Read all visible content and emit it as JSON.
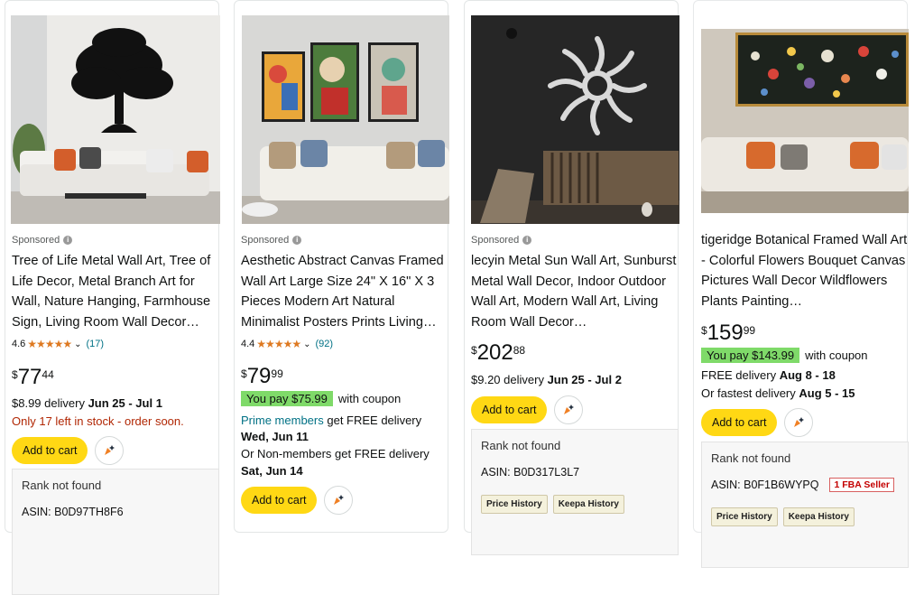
{
  "cards": [
    {
      "sponsored": "Sponsored",
      "title": "Tree of Life Metal Wall Art, Tree of Life Decor, Metal Branch Art for Wall, Nature Hanging, Farmhouse Sign, Living Room Wall Decor…",
      "rating": "4.6",
      "rating_fraction": 0.92,
      "review_count": "(17)",
      "price_symbol": "$",
      "price_whole": "77",
      "price_fraction": "44",
      "delivery_prefix": "$8.99 delivery ",
      "delivery_dates": "Jun 25 - Jul 1",
      "stock": "Only 17 left in stock - order soon.",
      "add_to_cart": "Add to cart",
      "rank": "Rank not found",
      "asin": "ASIN: B0D97TH8F6"
    },
    {
      "sponsored": "Sponsored",
      "title": "Aesthetic Abstract Canvas Framed Wall Art Large Size 24\" X 16\" X 3 Pieces Modern Art Natural Minimalist Posters Prints Living…",
      "rating": "4.4",
      "rating_fraction": 0.88,
      "review_count": "(92)",
      "price_symbol": "$",
      "price_whole": "79",
      "price_fraction": "99",
      "you_pay": "You pay $75.99",
      "with_coupon": "with coupon",
      "prime_link": "Prime members",
      "prime_rest": " get FREE delivery",
      "prime_date": "Wed, Jun 11",
      "nonmember": "Or Non-members get FREE delivery",
      "nonmember_date": "Sat, Jun 14",
      "add_to_cart": "Add to cart"
    },
    {
      "sponsored": "Sponsored",
      "title": "lecyin Metal Sun Wall Art, Sunburst Metal Wall Decor, Indoor Outdoor Wall Art, Modern Wall Art, Living Room Wall Decor…",
      "price_symbol": "$",
      "price_whole": "202",
      "price_fraction": "88",
      "delivery_prefix": "$9.20 delivery ",
      "delivery_dates": "Jun 25 - Jul 2",
      "add_to_cart": "Add to cart",
      "rank": "Rank not found",
      "asin": "ASIN: B0D317L3L7",
      "price_history": "Price History",
      "keepa_history": "Keepa History"
    },
    {
      "title": "tigeridge Botanical Framed Wall Art - Colorful Flowers Bouquet Canvas Pictures Wall Decor Wildflowers Plants Painting…",
      "price_symbol": "$",
      "price_whole": "159",
      "price_fraction": "99",
      "you_pay": "You pay $143.99",
      "with_coupon": "with coupon",
      "free_delivery": "FREE delivery ",
      "free_dates": "Aug 8 - 18",
      "fastest": "Or fastest delivery ",
      "fastest_dates": "Aug 5 - 15",
      "add_to_cart": "Add to cart",
      "rank": "Rank not found",
      "asin": "ASIN: B0F1B6WYPQ",
      "fba_badge": "1 FBA Seller",
      "price_history": "Price History",
      "keepa_history": "Keepa History"
    }
  ],
  "colors": {
    "cart_button": "#ffd814",
    "coupon_green": "#7fda69",
    "link": "#007185",
    "stock_red": "#b12704",
    "star": "#de7921"
  }
}
